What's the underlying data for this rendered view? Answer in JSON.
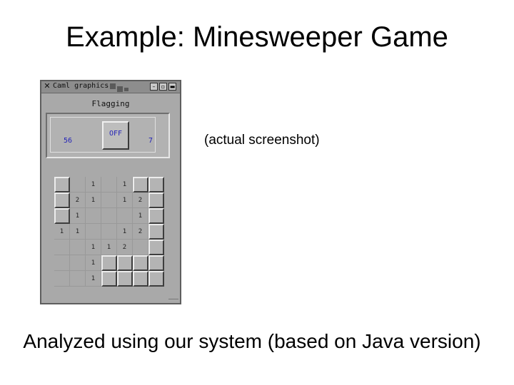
{
  "slide": {
    "title": "Example: Minesweeper Game",
    "caption_right": "(actual screenshot)",
    "caption_bottom": "Analyzed using our system (based on Java version)"
  },
  "window": {
    "title": "Caml graphics",
    "close_glyph": "✕",
    "controls": [
      "–",
      "▫",
      "▬"
    ],
    "status_label": "Flagging",
    "mine_count": "56",
    "flag_toggle": "OFF",
    "timer": "7"
  },
  "board": {
    "rows": 7,
    "cols": 7,
    "cells": [
      [
        "c",
        "",
        "1",
        "",
        "1",
        "c",
        "c"
      ],
      [
        "c",
        "2",
        "1",
        "",
        "1",
        "2",
        "c"
      ],
      [
        "c",
        "1",
        "",
        "",
        "",
        "1",
        "c"
      ],
      [
        "1",
        "1",
        "",
        "",
        "1",
        "2",
        "c"
      ],
      [
        "",
        "",
        "1",
        "1",
        "2",
        "",
        "c"
      ],
      [
        "",
        "",
        "1",
        "c",
        "c",
        "c",
        "c"
      ],
      [
        "",
        "",
        "1",
        "c",
        "c",
        "c",
        "c"
      ]
    ]
  },
  "colors": {
    "window_bg": "#a9a9a9",
    "counter_text": "#2323b8"
  }
}
